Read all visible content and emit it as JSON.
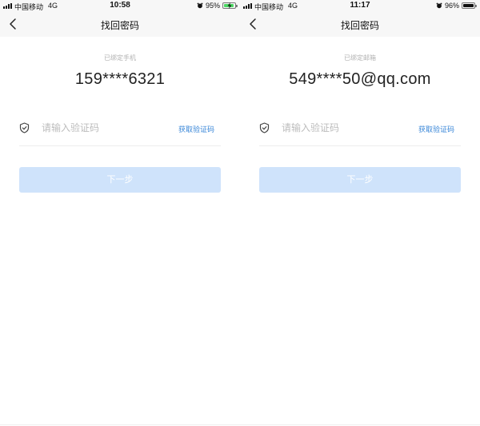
{
  "screens": [
    {
      "status": {
        "carrier": "中国移动",
        "network": "4G",
        "time": "10:58",
        "battery": "95%",
        "battery_level": 0.95,
        "charging": true
      },
      "nav": {
        "title": "找回密码"
      },
      "bound_label": "已绑定手机",
      "bound_value": "159****6321",
      "code_placeholder": "请输入验证码",
      "get_code_label": "获取验证码",
      "next_label": "下一步"
    },
    {
      "status": {
        "carrier": "中国移动",
        "network": "4G",
        "time": "11:17",
        "battery": "96%",
        "battery_level": 0.96,
        "charging": false
      },
      "nav": {
        "title": "找回密码"
      },
      "bound_label": "已绑定邮箱",
      "bound_value": "549****50@qq.com",
      "code_placeholder": "请输入验证码",
      "get_code_label": "获取验证码",
      "next_label": "下一步"
    }
  ],
  "colors": {
    "accent": "#3a87d8",
    "button_disabled": "#cfe3fb",
    "battery_charging": "#4cd964",
    "battery_normal": "#111111"
  },
  "icons": [
    "back-arrow-icon",
    "shield-icon",
    "alarm-icon",
    "battery-icon",
    "charging-icon",
    "signal-icon"
  ]
}
